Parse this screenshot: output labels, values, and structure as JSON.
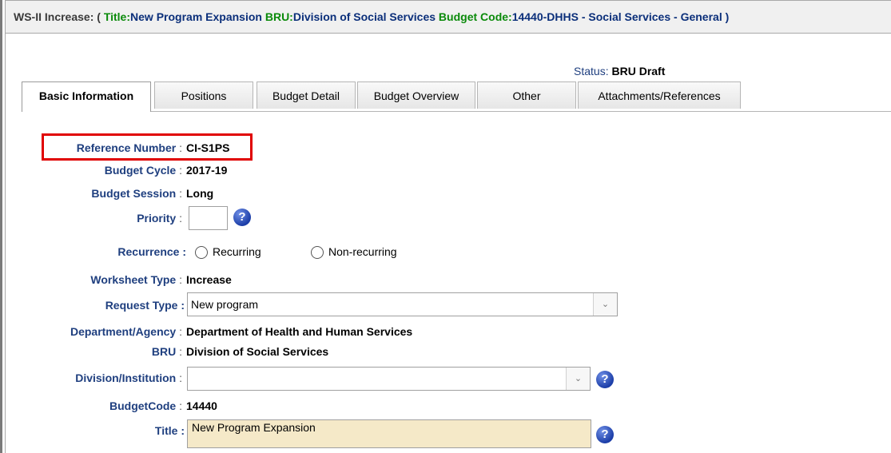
{
  "window": {
    "title_prefix": "WS-II Increase: (",
    "title_label": "Title:",
    "title_value": "New Program Expansion",
    "bru_label": "BRU:",
    "bru_value": "Division of Social Services",
    "budget_code_label": "Budget Code:",
    "budget_code_value": "14440-DHHS - Social Services - General )"
  },
  "status": {
    "label": "Status:",
    "value": "BRU Draft"
  },
  "tabs": [
    {
      "label": "Basic Information",
      "active": true
    },
    {
      "label": "Positions"
    },
    {
      "label": "Budget Detail"
    },
    {
      "label": "Budget Overview"
    },
    {
      "label": "Other"
    },
    {
      "label": "Attachments/References"
    }
  ],
  "form": {
    "reference_number": {
      "label": "Reference Number",
      "value": "CI-S1PS"
    },
    "budget_cycle": {
      "label": "Budget Cycle",
      "value": "2017-19"
    },
    "budget_session": {
      "label": "Budget Session",
      "value": "Long"
    },
    "priority": {
      "label": "Priority",
      "value": ""
    },
    "recurrence": {
      "label": "Recurrence :",
      "options": [
        "Recurring",
        "Non-recurring"
      ],
      "selected": ""
    },
    "worksheet_type": {
      "label": "Worksheet Type",
      "value": "Increase"
    },
    "request_type": {
      "label": "Request Type :",
      "value": "New program"
    },
    "department": {
      "label": "Department/Agency",
      "value": "Department of Health and Human Services"
    },
    "bru": {
      "label": "BRU",
      "value": "Division of Social Services"
    },
    "division": {
      "label": "Division/Institution",
      "value": ""
    },
    "budget_code": {
      "label": "BudgetCode",
      "value": "14440"
    },
    "title": {
      "label": "Title :",
      "value": "New Program Expansion"
    }
  },
  "icons": {
    "help": "help-icon",
    "dropdown": "chevron-down-icon"
  },
  "colors": {
    "label_blue": "#1f3f7f",
    "title_green": "#0a8a0a",
    "highlight_red": "#e00000",
    "title_field_bg": "#f5e9c8"
  }
}
